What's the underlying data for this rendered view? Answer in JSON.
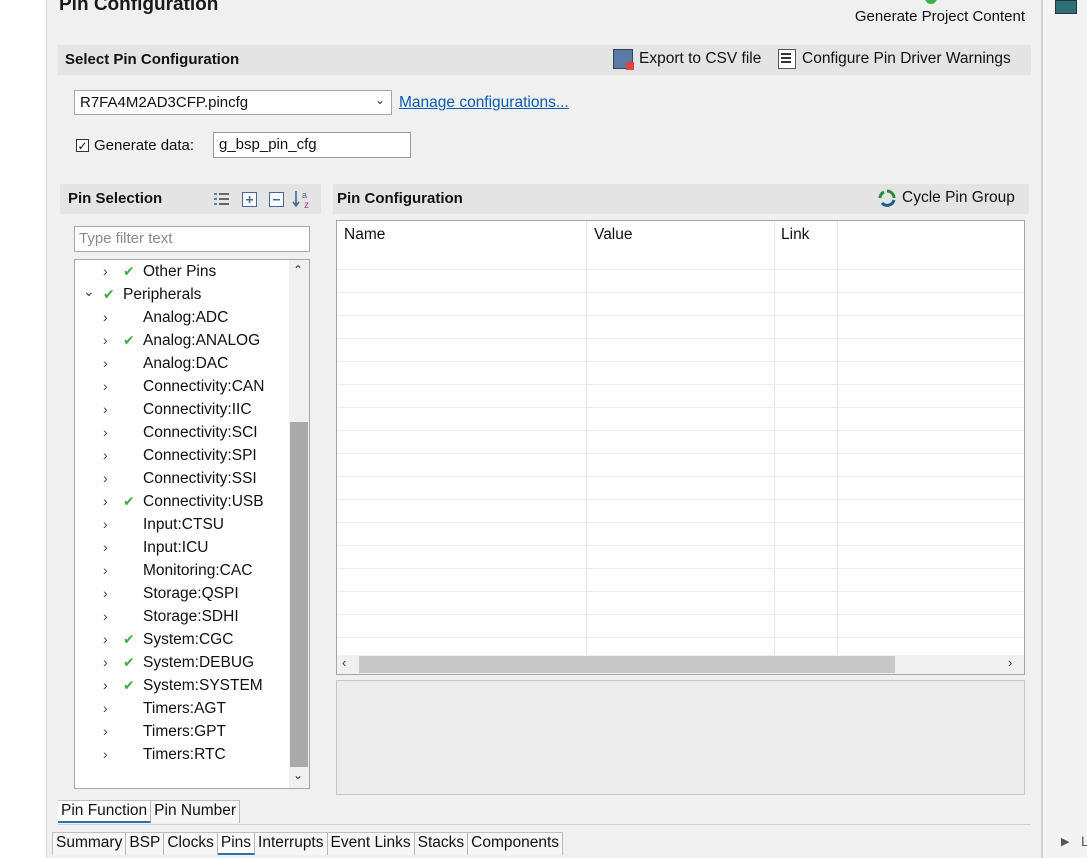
{
  "header": {
    "title": "Pin Configuration",
    "generate_label": "Generate Project Content"
  },
  "select_section": {
    "title": "Select Pin Configuration",
    "export_label": "Export to CSV file",
    "warnings_label": "Configure Pin Driver Warnings",
    "config_value": "R7FA4M2AD3CFP.pincfg",
    "manage_link": "Manage configurations...",
    "generate_data_label": "Generate data:",
    "generate_data_checked": true,
    "generate_data_value": "g_bsp_pin_cfg"
  },
  "pin_selection": {
    "title": "Pin Selection",
    "filter_placeholder": "Type filter text",
    "tree": [
      {
        "label": "Other Pins",
        "checked": true,
        "expanded": false,
        "level": 0
      },
      {
        "label": "Peripherals",
        "checked": true,
        "expanded": true,
        "level": 0
      },
      {
        "label": "Analog:ADC",
        "checked": false,
        "level": 1
      },
      {
        "label": "Analog:ANALOG",
        "checked": true,
        "level": 1
      },
      {
        "label": "Analog:DAC",
        "checked": false,
        "level": 1
      },
      {
        "label": "Connectivity:CAN",
        "checked": false,
        "level": 1
      },
      {
        "label": "Connectivity:IIC",
        "checked": false,
        "level": 1
      },
      {
        "label": "Connectivity:SCI",
        "checked": false,
        "level": 1
      },
      {
        "label": "Connectivity:SPI",
        "checked": false,
        "level": 1
      },
      {
        "label": "Connectivity:SSI",
        "checked": false,
        "level": 1
      },
      {
        "label": "Connectivity:USB",
        "checked": true,
        "level": 1
      },
      {
        "label": "Input:CTSU",
        "checked": false,
        "level": 1
      },
      {
        "label": "Input:ICU",
        "checked": false,
        "level": 1
      },
      {
        "label": "Monitoring:CAC",
        "checked": false,
        "level": 1
      },
      {
        "label": "Storage:QSPI",
        "checked": false,
        "level": 1
      },
      {
        "label": "Storage:SDHI",
        "checked": false,
        "level": 1
      },
      {
        "label": "System:CGC",
        "checked": true,
        "level": 1
      },
      {
        "label": "System:DEBUG",
        "checked": true,
        "level": 1
      },
      {
        "label": "System:SYSTEM",
        "checked": true,
        "level": 1
      },
      {
        "label": "Timers:AGT",
        "checked": false,
        "level": 1
      },
      {
        "label": "Timers:GPT",
        "checked": false,
        "level": 1
      },
      {
        "label": "Timers:RTC",
        "checked": false,
        "level": 1
      }
    ]
  },
  "pin_configuration": {
    "title": "Pin Configuration",
    "cycle_label": "Cycle Pin Group",
    "columns": [
      "Name",
      "Value",
      "Link"
    ]
  },
  "bottom_tabs": [
    {
      "label": "Pin Function",
      "active": true
    },
    {
      "label": "Pin Number",
      "active": false
    }
  ],
  "editor_tabs": [
    {
      "label": "Summary",
      "active": false
    },
    {
      "label": "BSP",
      "active": false
    },
    {
      "label": "Clocks",
      "active": false
    },
    {
      "label": "Pins",
      "active": true
    },
    {
      "label": "Interrupts",
      "active": false
    },
    {
      "label": "Event Links",
      "active": false
    },
    {
      "label": "Stacks",
      "active": false
    },
    {
      "label": "Components",
      "active": false
    }
  ],
  "icons": {
    "generate": "generate-icon",
    "export": "csv-export-icon",
    "warnings": "driver-warnings-icon",
    "cycle": "cycle-icon",
    "expand_all": "expand-all-icon",
    "collapse_all": "collapse-all-icon",
    "list": "list-icon",
    "sort": "sort-az-icon"
  },
  "colors": {
    "tick": "#3fae49",
    "link": "#0b5cb4",
    "panel_header": "#e4e4e4"
  }
}
